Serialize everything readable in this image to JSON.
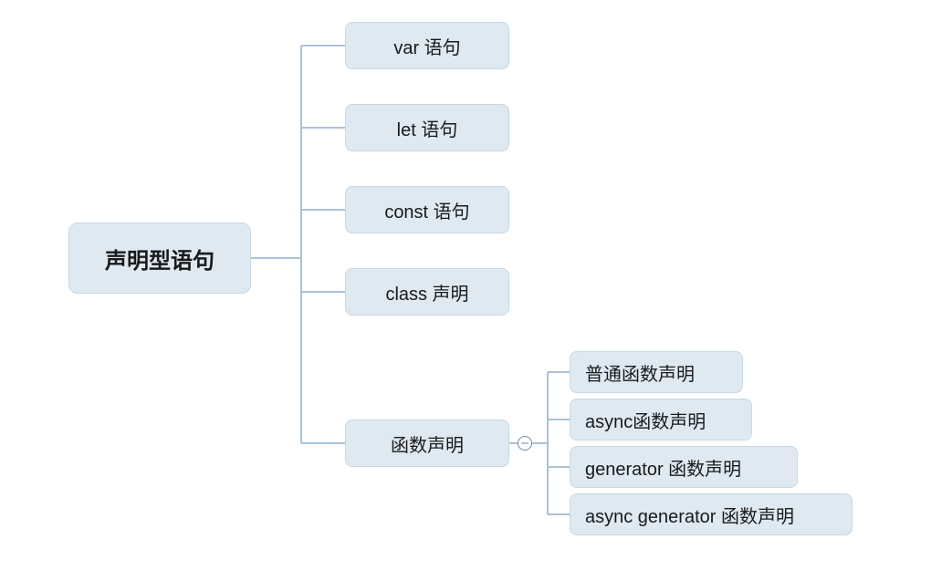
{
  "root": {
    "label": "声明型语句"
  },
  "children": [
    {
      "label": "var 语句"
    },
    {
      "label": "let 语句"
    },
    {
      "label": "const 语句"
    },
    {
      "label": "class 声明"
    },
    {
      "label": "函数声明"
    }
  ],
  "functionChildren": [
    {
      "label": "普通函数声明"
    },
    {
      "label": "async函数声明"
    },
    {
      "label": "generator 函数声明"
    },
    {
      "label": "async generator 函数声明"
    }
  ],
  "colors": {
    "nodeFill": "#dee9f2",
    "nodeBorder": "#c8d8e6",
    "connector": "#aac2d8"
  }
}
